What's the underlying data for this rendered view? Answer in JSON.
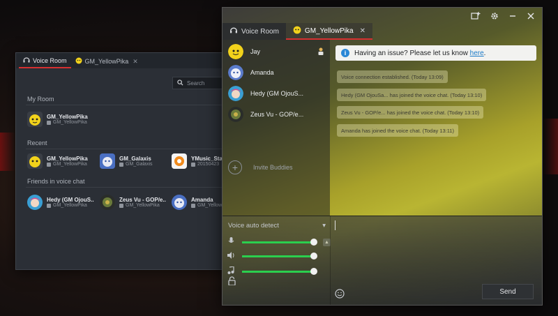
{
  "back_window": {
    "tabs": [
      {
        "label": "Voice Room",
        "icon": "headset-icon",
        "active": true
      },
      {
        "label": "GM_YellowPika",
        "icon": "avatar-pika",
        "active": false
      }
    ],
    "search_placeholder": "Search",
    "sections": {
      "my_room": "My Room",
      "recent": "Recent",
      "friends": "Friends in voice chat"
    },
    "my_room": {
      "name": "GM_YellowPika",
      "sub": "GM_YellowPika"
    },
    "recent": [
      {
        "name": "GM_YellowPika",
        "sub": "GM_YellowPika"
      },
      {
        "name": "GM_Galaxis",
        "sub": "GM_Galaxis"
      },
      {
        "name": "YMusic_Stat",
        "sub": "20150423"
      }
    ],
    "friends": [
      {
        "name": "Hedy (GM OjouS..",
        "sub": "GM_YellowPika"
      },
      {
        "name": "Zeus Vu - GOP/e..",
        "sub": "GM_YellowPika"
      },
      {
        "name": "Amanda",
        "sub": "GM_YellowPi"
      }
    ]
  },
  "front_window": {
    "tabs": [
      {
        "label": "Voice Room",
        "icon": "headset-icon",
        "active": false
      },
      {
        "label": "GM_YellowPika",
        "icon": "avatar-pika",
        "active": true
      }
    ],
    "participants": [
      {
        "name": "Jay",
        "host": true
      },
      {
        "name": "Amanda",
        "host": false
      },
      {
        "name": "Hedy (GM OjouS...",
        "host": false
      },
      {
        "name": "Zeus Vu - GOP/e...",
        "host": false
      }
    ],
    "invite_label": "Invite Buddies",
    "notice": {
      "text": "Having an issue? Please let us know ",
      "link": "here",
      "end": "."
    },
    "messages": [
      "Voice connection established. (Today 13:09)",
      "Hedy (GM OjouSa... has joined the voice chat. (Today 13:10)",
      "Zeus Vu - GOP/e... has joined the voice chat. (Today 13:10)",
      "Amanda has joined the voice chat. (Today 13:11)"
    ],
    "voice_mode": "Voice auto detect",
    "sliders": {
      "mic": 1.0,
      "speaker": 1.0,
      "music": 1.0
    },
    "send_label": "Send",
    "accent_color": "#d63030",
    "slider_color": "#2bcf4e"
  }
}
